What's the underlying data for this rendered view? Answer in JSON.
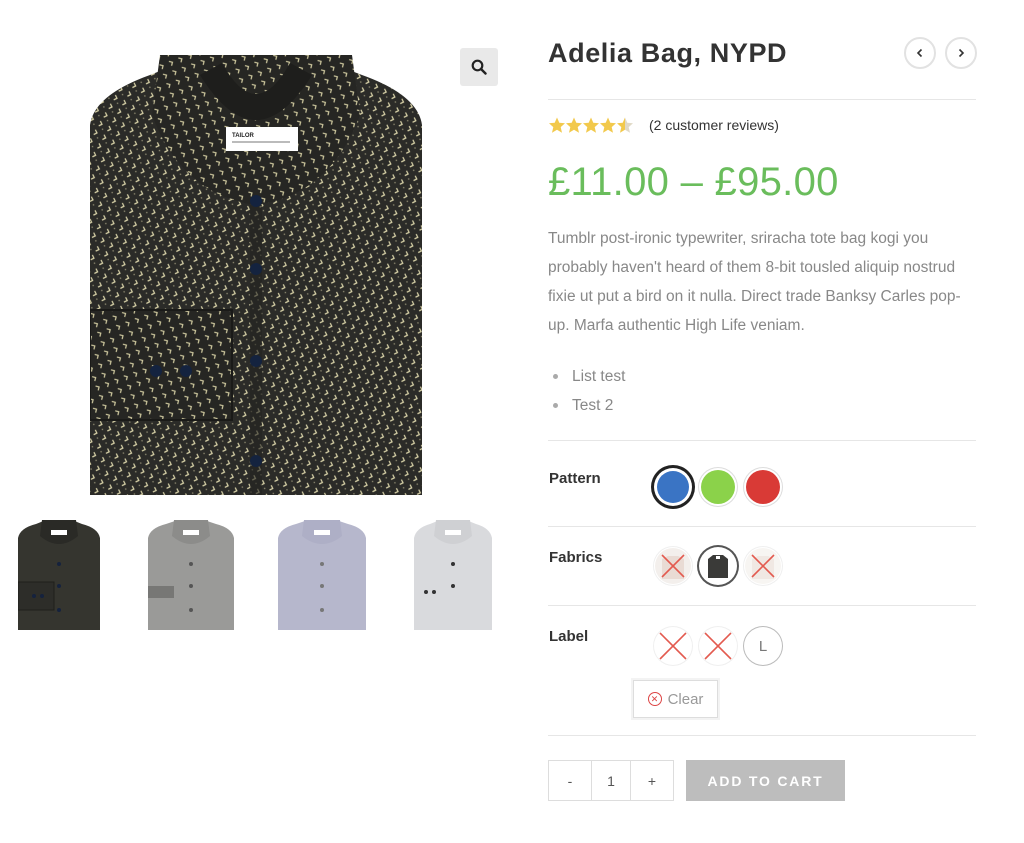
{
  "product": {
    "title": "Adelia Bag, NYPD",
    "rating": 4.5,
    "reviews_text": "(2 customer reviews)",
    "price_range": "£11.00 – £95.00",
    "description": "Tumblr post-ironic typewriter, sriracha tote bag kogi you probably haven't heard of them 8-bit tousled aliquip nostrud fixie ut put a bird on it nulla. Direct trade Banksy Carles pop-up. Marfa authentic High Life veniam.",
    "bullets": [
      "List test",
      "Test 2"
    ],
    "label_tag": "TAILOR"
  },
  "gallery": {
    "main_image_icon": "shirt-image",
    "zoom_icon": "search-icon",
    "thumbnails": [
      "dark-patterned-shirt",
      "grey-shirt",
      "lavender-shirt",
      "light-grey-shirt"
    ]
  },
  "navigation": {
    "prev_icon": "chevron-left-icon",
    "next_icon": "chevron-right-icon"
  },
  "attributes": {
    "pattern": {
      "label": "Pattern",
      "options": [
        {
          "color": "#3a74c4",
          "selected": true
        },
        {
          "color": "#8bd24a",
          "selected": false
        },
        {
          "color": "#d93a36",
          "selected": false
        }
      ]
    },
    "fabrics": {
      "label": "Fabrics",
      "options": [
        {
          "name": "light-fabric",
          "available": false
        },
        {
          "name": "dark-fabric",
          "available": true,
          "selected": true
        },
        {
          "name": "white-fabric",
          "available": false
        }
      ]
    },
    "label": {
      "label": "Label",
      "options": [
        {
          "value": "",
          "available": false
        },
        {
          "value": "",
          "available": false
        },
        {
          "value": "L",
          "available": true
        }
      ]
    },
    "clear_label": "Clear"
  },
  "cart": {
    "minus": "-",
    "quantity": "1",
    "plus": "+",
    "add_label": "ADD TO CART"
  },
  "colors": {
    "price": "#6abd5c",
    "disabled_cross": "#e0493d",
    "button": "#bdbdbd"
  }
}
